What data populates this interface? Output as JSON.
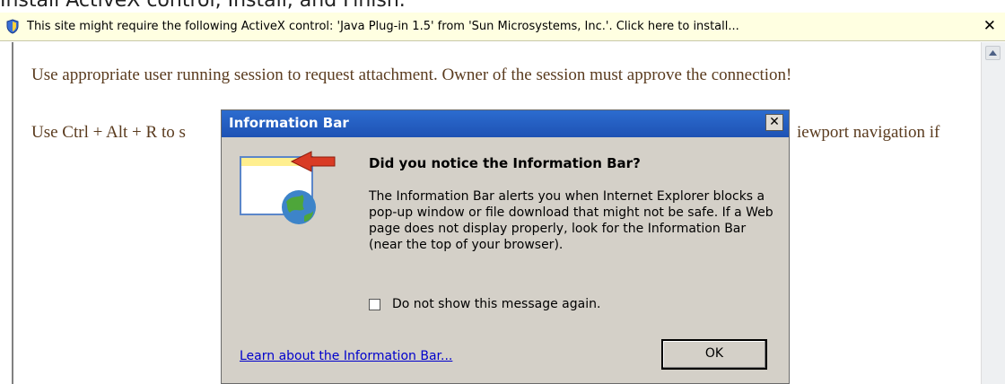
{
  "caption": "Install ActiveX control, Install, and Finish.",
  "infobar": {
    "message": "This site might require the following ActiveX control: 'Java Plug-in  1.5' from 'Sun Microsystems, Inc.'. Click here to install...",
    "close_glyph": "✕"
  },
  "page": {
    "line1": "Use appropriate user running session to request attachment. Owner of the session must approve the connection!",
    "line2_start": "Use Ctrl + Alt + R to s",
    "line2_end": "iewport navigation if"
  },
  "dialog": {
    "title": "Information Bar",
    "close_glyph": "✕",
    "heading": "Did you notice the Information Bar?",
    "body": "The Information Bar alerts you when Internet Explorer blocks a pop-up window or file download that might not be safe. If a Web page does not display properly, look for the Information Bar (near the top of your browser).",
    "checkbox_label": "Do not show this message again.",
    "checkbox_checked": false,
    "link": "Learn about the Information Bar...",
    "ok_label": "OK"
  },
  "colors": {
    "infobar_bg": "#ffffe1",
    "page_text": "#5a3b1e",
    "titlebar": "#1e52b4",
    "dialog_bg": "#d4d0c8",
    "link": "#0000cc"
  }
}
